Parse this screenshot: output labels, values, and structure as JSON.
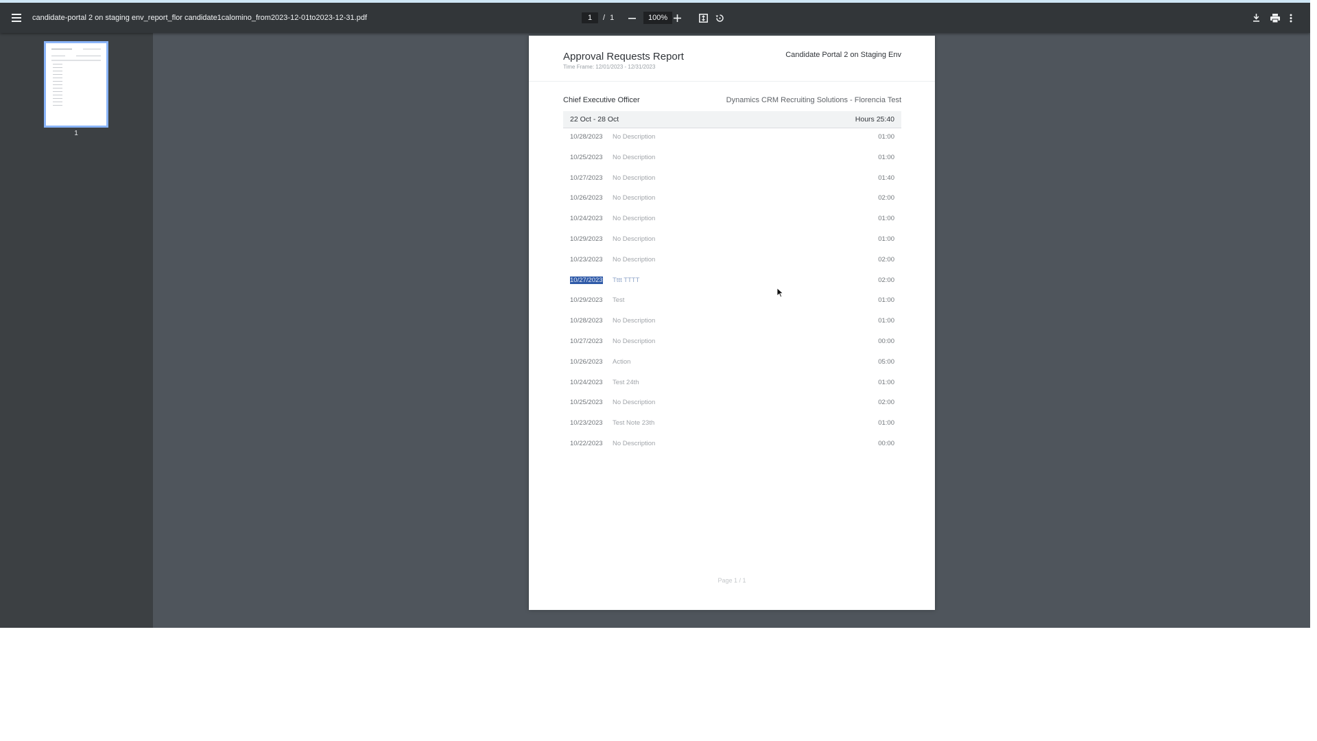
{
  "toolbar": {
    "file_name": "candidate-portal 2 on staging env_report_flor candidate1calomino_from2023-12-01to2023-12-31.pdf",
    "current_page": "1",
    "page_separator": "/",
    "total_pages": "1",
    "zoom": "100%",
    "icons": [
      "menu-icon",
      "zoom-out-icon",
      "zoom-in-icon",
      "fit-page-icon",
      "rotate-icon",
      "download-icon",
      "print-icon",
      "more-vert-icon"
    ]
  },
  "sidebar": {
    "thumbnail_label": "1"
  },
  "document": {
    "title": "Approval Requests Report",
    "time_frame": "Time Frame: 12/01/2023 - 12/31/2023",
    "org": "Candidate Portal 2 on Staging Env",
    "person_role": "Chief Executive Officer",
    "client": "Dynamics CRM Recruiting Solutions - Florencia Test",
    "week": {
      "label": "22 Oct - 28 Oct",
      "hours": "Hours 25:40"
    },
    "entries": [
      {
        "date": "10/28/2023",
        "description": "No Description",
        "hours": "01:00"
      },
      {
        "date": "10/25/2023",
        "description": "No Description",
        "hours": "01:00"
      },
      {
        "date": "10/27/2023",
        "description": "No Description",
        "hours": "01:40"
      },
      {
        "date": "10/26/2023",
        "description": "No Description",
        "hours": "02:00"
      },
      {
        "date": "10/24/2023",
        "description": "No Description",
        "hours": "01:00"
      },
      {
        "date": "10/29/2023",
        "description": "No Description",
        "hours": "01:00"
      },
      {
        "date": "10/23/2023",
        "description": "No Description",
        "hours": "02:00"
      },
      {
        "date": "10/27/2023",
        "description": "Tttt TTTT",
        "hours": "02:00"
      },
      {
        "date": "10/29/2023",
        "description": "Test",
        "hours": "01:00"
      },
      {
        "date": "10/28/2023",
        "description": "No Description",
        "hours": "01:00"
      },
      {
        "date": "10/27/2023",
        "description": "No Description",
        "hours": "00:00"
      },
      {
        "date": "10/26/2023",
        "description": "Action",
        "hours": "05:00"
      },
      {
        "date": "10/24/2023",
        "description": "Test 24th",
        "hours": "01:00"
      },
      {
        "date": "10/25/2023",
        "description": "No Description",
        "hours": "02:00"
      },
      {
        "date": "10/23/2023",
        "description": "Test Note 23th",
        "hours": "01:00"
      },
      {
        "date": "10/22/2023",
        "description": "No Description",
        "hours": "00:00"
      }
    ],
    "footer": "Page 1 / 1"
  }
}
